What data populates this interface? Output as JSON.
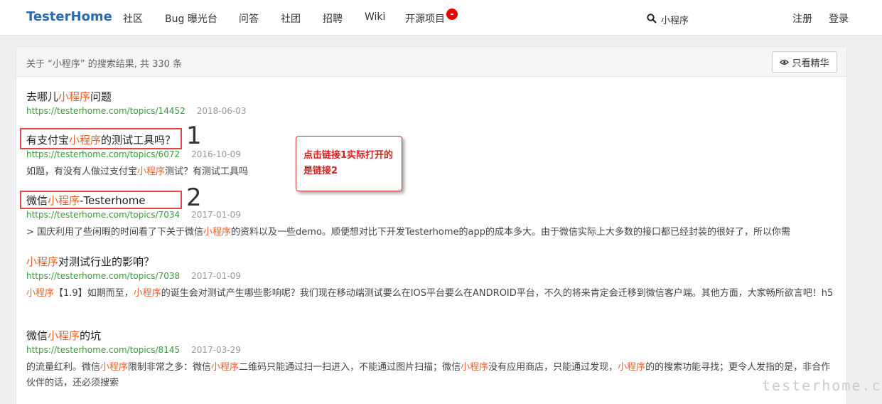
{
  "nav": {
    "brand": "TesterHome",
    "items": [
      "社区",
      "Bug 曝光台",
      "问答",
      "社团",
      "招聘",
      "Wiki",
      "开源项目"
    ],
    "search_value": "小程序",
    "register": "注册",
    "login": "登录"
  },
  "search": {
    "summary": "关于 “小程序” 的搜索结果, 共 330 条",
    "filter_label": "只看精华"
  },
  "results": [
    {
      "title_parts": [
        "去哪儿",
        "小程序",
        "问题"
      ],
      "url": "https://testerhome.com/topics/14452",
      "date": "2018-06-03",
      "excerpt_parts": []
    },
    {
      "title_parts": [
        "有支付宝",
        "小程序",
        "的测试工具吗？"
      ],
      "url": "https://testerhome.com/topics/6072",
      "date": "2016-10-09",
      "excerpt_parts": [
        "如题，有没有人做过支付宝",
        "小程序",
        "测试？有测试工具吗"
      ]
    },
    {
      "title_parts": [
        "微信",
        "小程序",
        "-Testerhome"
      ],
      "url": "https://testerhome.com/topics/7034",
      "date": "2017-01-09",
      "excerpt_parts": [
        "> 国庆利用了些闲暇的时间看了下关于微信",
        "小程序",
        "的资料以及一些demo。顺便想对比下开发Testerhome的app的成本多大。由于微信实际上大多数的接口都已经封装的很好了，所以你需"
      ]
    },
    {
      "title_parts": [
        "",
        "小程序",
        "对测试行业的影响？"
      ],
      "url": "https://testerhome.com/topics/7038",
      "date": "2017-01-09",
      "excerpt_parts": [
        "",
        "小程序",
        "【1.9】如期而至，",
        "小程序",
        "的诞生会对测试产生哪些影响呢？我们现在移动端测试要么在IOS平台要么在ANDROID平台，不久的将来肯定会迁移到微信客户端。其他方面，大家畅所欲言吧！h5"
      ]
    },
    {
      "title_parts": [
        "微信",
        "小程序",
        "的坑"
      ],
      "url": "https://testerhome.com/topics/8145",
      "date": "2017-03-29",
      "excerpt_parts": [
        "的流量红利。微信",
        "小程序",
        "限制非常之多：微信",
        "小程序",
        "二维码只能通过扫一扫进入，不能通过图片扫描；微信",
        "小程序",
        "没有应用商店，只能通过发现，",
        "小程序",
        "的的搜索功能寻找；更令人发指的是，非合作伙伴的话，还必须搜索"
      ]
    }
  ],
  "annotations": {
    "marker_1": "1",
    "marker_2": "2",
    "note": "点击链接1实际打开的是链接2"
  },
  "watermark": "testerhome.com",
  "colors": {
    "brand": "#2a6bb5",
    "highlight": "#e8612c",
    "url": "#3a9a3a",
    "annotation_red": "#d62020"
  }
}
